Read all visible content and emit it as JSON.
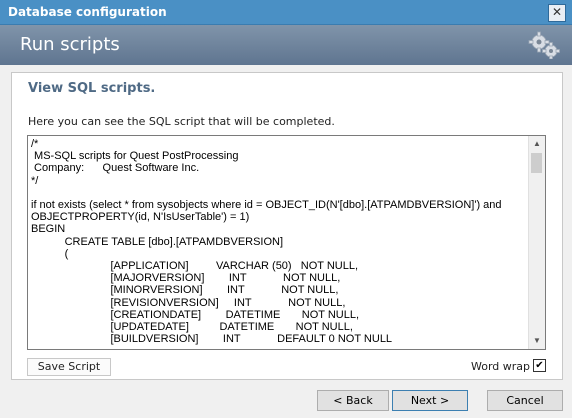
{
  "window": {
    "title": "Database configuration",
    "close_glyph": "✕"
  },
  "header": {
    "title": "Run scripts",
    "icon": "gears-icon"
  },
  "main": {
    "section_title": "View SQL scripts.",
    "description": "Here you can see the SQL script that will be completed.",
    "script_lines": [
      "/*",
      " MS-SQL scripts for Quest PostProcessing",
      " Company:      Quest Software Inc.",
      "*/",
      "",
      "if not exists (select * from sysobjects where id = OBJECT_ID(N'[dbo].[ATPAMDBVERSION]') and",
      "OBJECTPROPERTY(id, N'IsUserTable') = 1)",
      "BEGIN",
      "           CREATE TABLE [dbo].[ATPAMDBVERSION]",
      "           (",
      "                          [APPLICATION]         VARCHAR (50)   NOT NULL,",
      "                          [MAJORVERSION]        INT            NOT NULL,",
      "                          [MINORVERSION]        INT            NOT NULL,",
      "                          [REVISIONVERSION]     INT            NOT NULL,",
      "                          [CREATIONDATE]        DATETIME       NOT NULL,",
      "                          [UPDATEDATE]          DATETIME       NOT NULL,",
      "                          [BUILDVERSION]        INT            DEFAULT 0 NOT NULL"
    ],
    "save_button": "Save Script",
    "word_wrap_label": "Word wrap",
    "word_wrap_checked": "✔"
  },
  "footer": {
    "back": "< Back",
    "next": "Next >",
    "cancel": "Cancel"
  }
}
